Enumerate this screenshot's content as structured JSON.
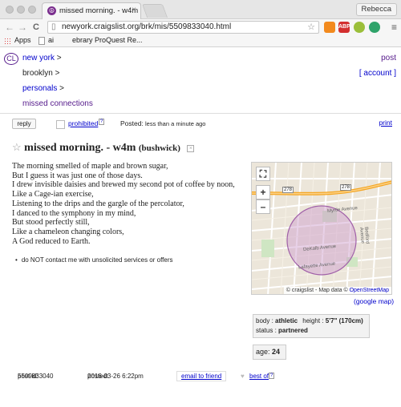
{
  "browser": {
    "tab_title": "missed morning. - w4m",
    "tab_close": "×",
    "profile_name": "Rebecca",
    "url": "newyork.craigslist.org/brk/mis/5509833040.html",
    "back_glyph": "←",
    "forward_glyph": "→",
    "reload_glyph": "C",
    "star_glyph": "☆",
    "menu_glyph": "≡",
    "extensions": [
      {
        "name": "bookmark-extension-icon",
        "label": "",
        "color": "#f28a1e"
      },
      {
        "name": "adblock-extension-icon",
        "label": "ABP",
        "color": "#d32f2f"
      },
      {
        "name": "hangouts-extension-icon",
        "label": "",
        "color": "#9bbf3a"
      },
      {
        "name": "sync-extension-icon",
        "label": "",
        "color": "#2fa36a"
      }
    ],
    "bookmarks": {
      "apps": "Apps",
      "item1": "ai",
      "item2": "ebrary ProQuest Re..."
    }
  },
  "header": {
    "logo": "CL",
    "crumbs": {
      "new_york": "new york",
      "brooklyn": "brooklyn",
      "personals": "personals",
      "missed_connections": "missed connections",
      "sep": ">"
    },
    "post": "post",
    "account": "[ account ]"
  },
  "postbar": {
    "reply": "reply",
    "prohibited": "prohibited",
    "help_mark": "?",
    "posted_label": "Posted:",
    "posted_value": "less than a minute ago",
    "print": "print"
  },
  "posting": {
    "star": "☆",
    "title": "missed morning. - w4m",
    "location": "(bushwick)",
    "hide_mark": "×",
    "body_lines": [
      "The morning smelled of maple and brown sugar,",
      "But I guess it was just one of those days.",
      "I drew invisible daisies and brewed my second pot of coffee by noon,",
      "Like a Cage-ian exercise,",
      "Listening to the drips and the gargle of the percolator,",
      "I danced to the symphony in my mind,",
      "But stood perfectly still,",
      "Like a chameleon changing colors,",
      "A God reduced to Earth."
    ],
    "notice": "do NOT contact me with unsolicited services or offers"
  },
  "map": {
    "attribution_prefix": "© craigslist - Map data ©",
    "attribution_link": "OpenStreetMap",
    "google_map": "(google map)",
    "zoom_in": "+",
    "zoom_out": "–",
    "street_labels": [
      "Myrtle Avenue",
      "DeKalb Avenue",
      "Lafayette Avenue",
      "Bedford Avenue"
    ],
    "route_labels": [
      "278",
      "278"
    ],
    "area_color": "#cc99cc"
  },
  "attributes": {
    "body_label": "body :",
    "body_value": "athletic",
    "height_label": "height :",
    "height_value": "5'7\" (170cm)",
    "status_label": "status :",
    "status_value": "partnered",
    "age_label": "age:",
    "age_value": "24"
  },
  "footer": {
    "post_id_label": "post id:",
    "post_id_value": "5509833040",
    "posted_label": "posted:",
    "posted_value": "2016-03-26 6:22pm",
    "email_friend": "email to friend",
    "heart": "♥",
    "best_of": "best of",
    "help_mark": "?"
  }
}
